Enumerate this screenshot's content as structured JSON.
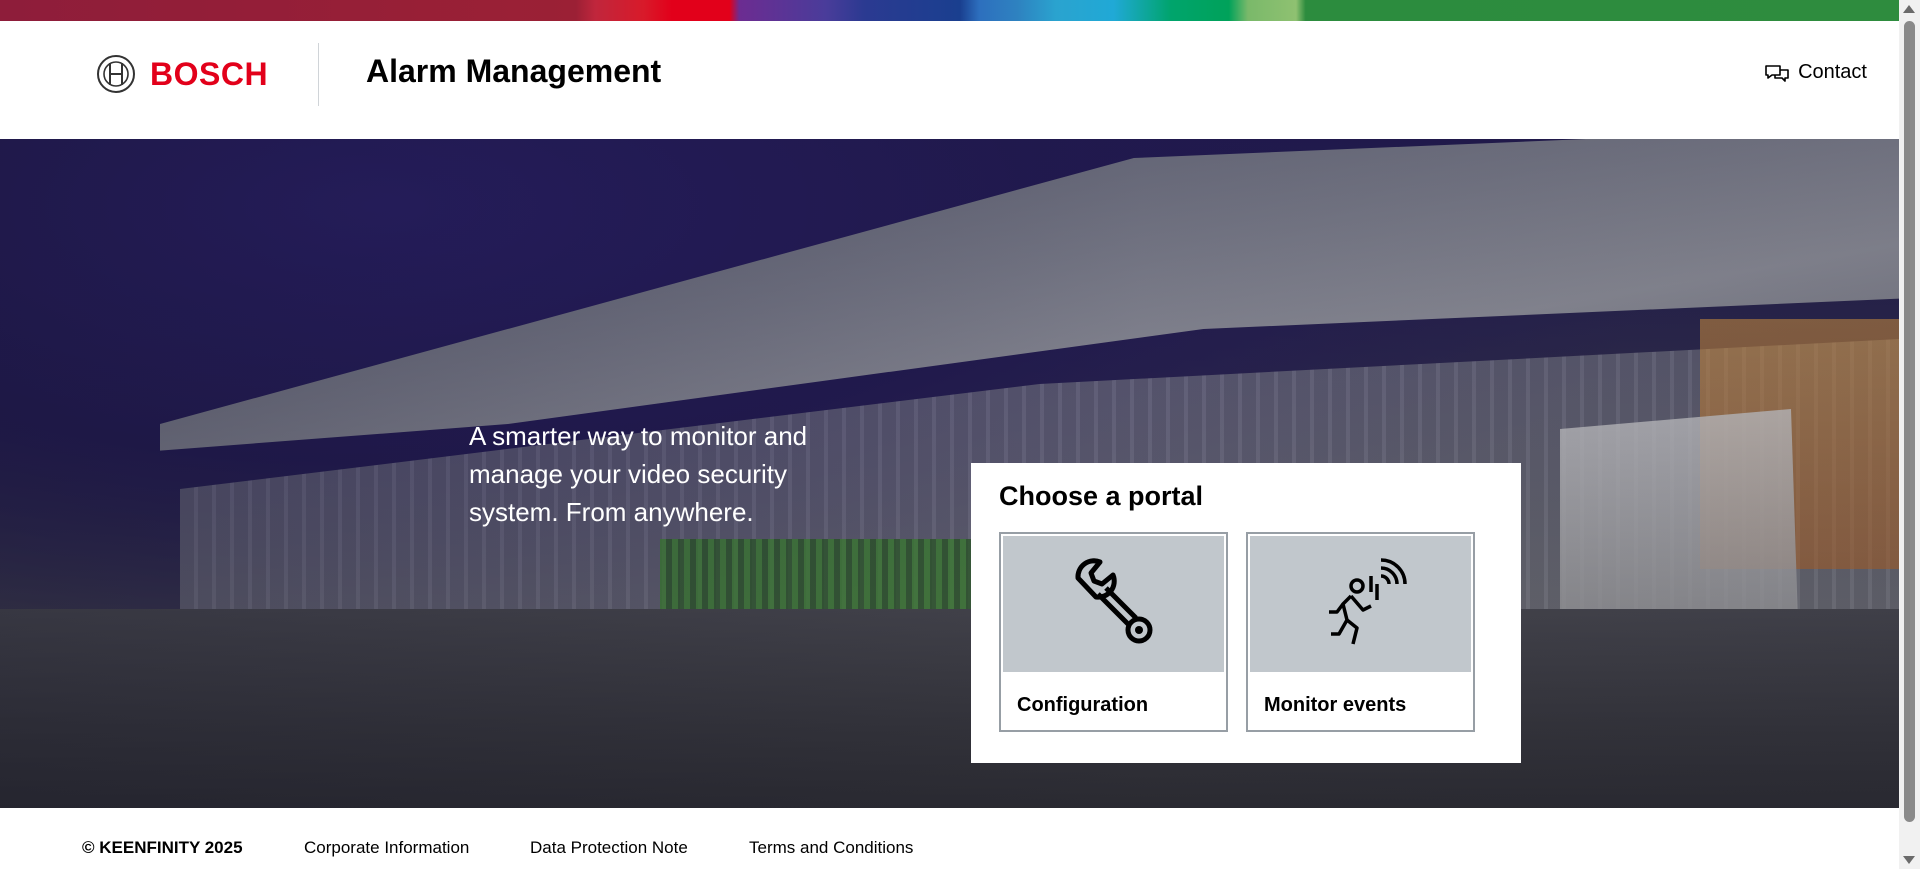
{
  "brand": {
    "name": "BOSCH",
    "color": "#e2001a",
    "logo_icon": "bosch-armature-icon"
  },
  "header": {
    "app_title": "Alarm Management",
    "contact_label": "Contact",
    "contact_icon": "chat-bubbles-icon"
  },
  "hero": {
    "tagline": "A smarter way to monitor and manage your video security system. From anywhere."
  },
  "portal": {
    "title": "Choose a portal",
    "tiles": [
      {
        "label": "Configuration",
        "icon": "wrench-icon"
      },
      {
        "label": "Monitor events",
        "icon": "intruder-motion-icon"
      }
    ]
  },
  "footer": {
    "copyright": "© KEENFINITY 2025",
    "links": [
      "Corporate Information",
      "Data Protection Note",
      "Terms and Conditions"
    ]
  },
  "colors": {
    "tile_background": "#c1c7cc",
    "tile_border": "#979ea5"
  }
}
